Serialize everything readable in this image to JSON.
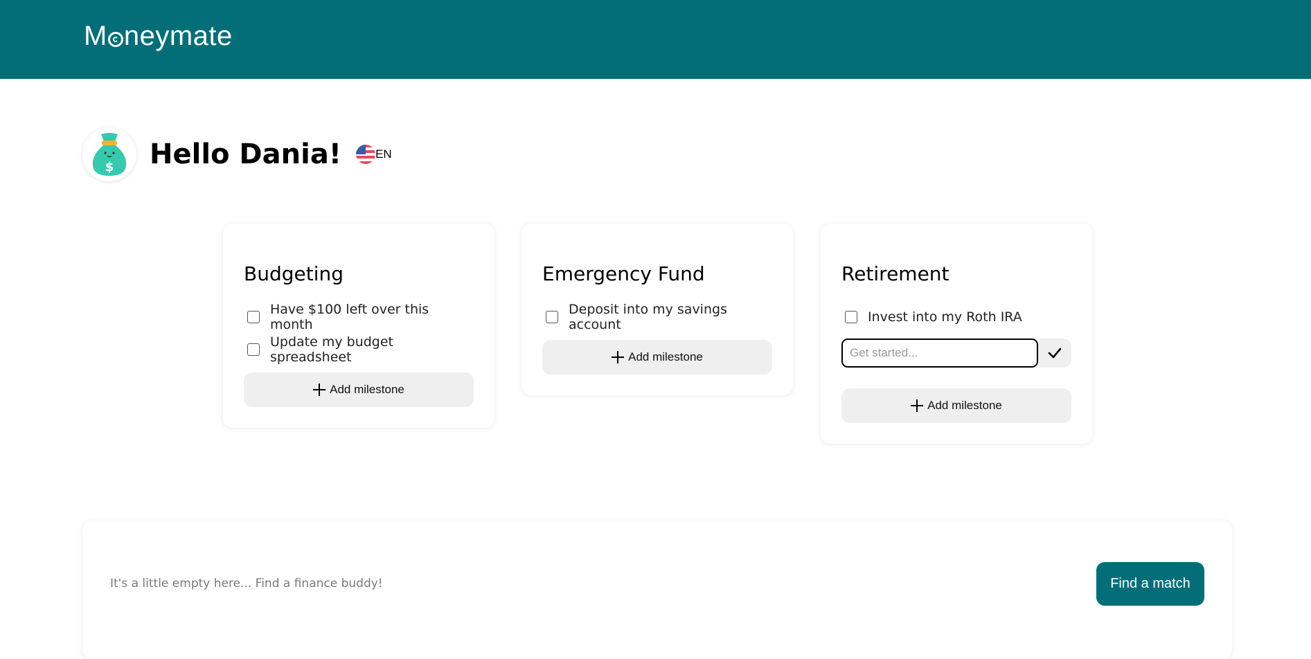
{
  "header": {
    "logo_prefix": "M",
    "logo_suffix": "neymate",
    "logo_icon": "refresh-circle-icon",
    "brand_color": "#036e78"
  },
  "greeting": {
    "avatar_icon": "money-bag-icon",
    "text": "Hello Dania!",
    "language": "EN",
    "flag_icon": "us-flag-icon"
  },
  "cards": [
    {
      "title": "Budgeting",
      "milestones": [
        "Have $100 left over this month",
        "Update my budget spreadsheet"
      ],
      "add_label": "Add milestone"
    },
    {
      "title": "Emergency Fund",
      "milestones": [
        "Deposit into my savings account"
      ],
      "add_label": "Add milestone"
    },
    {
      "title": "Retirement",
      "milestones": [
        "Invest into my Roth IRA"
      ],
      "new_milestone_placeholder": "Get started...",
      "add_label": "Add milestone"
    }
  ],
  "buddy": {
    "empty_text": "It's a little empty here... Find a finance buddy!",
    "button_label": "Find a match"
  }
}
